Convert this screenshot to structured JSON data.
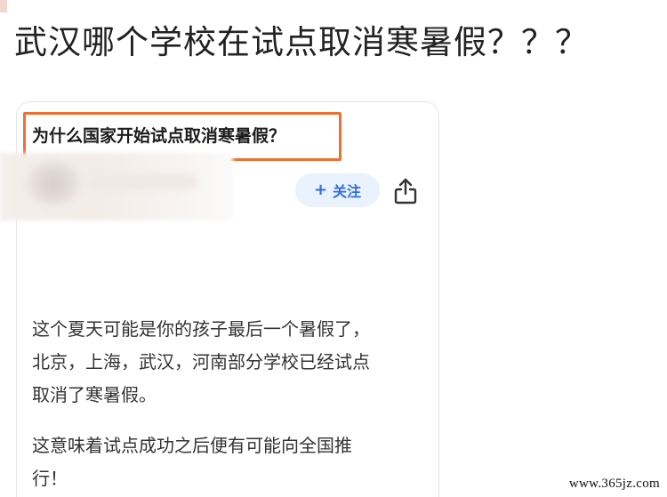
{
  "headline": "武汉哪个学校在试点取消寒暑假？？？",
  "card": {
    "question": "为什么国家开始试点取消寒暑假？",
    "follow_button": {
      "icon": "plus-icon",
      "label": "关注"
    },
    "share_icon": "share-icon",
    "paragraphs": [
      [
        "这个夏天可能是你的孩子最后一个暑假了，",
        "北京，上海，武汉，河南部分学校已经试点",
        "取消了寒暑假。"
      ],
      [
        "这意味着试点成功之后便有可能向全国推",
        "行！"
      ]
    ]
  },
  "colors": {
    "highlight_border": "#ee6f33",
    "follow_bg": "#e9f2fd",
    "follow_text": "#2f6de1"
  },
  "watermark": "www.365jz.com"
}
